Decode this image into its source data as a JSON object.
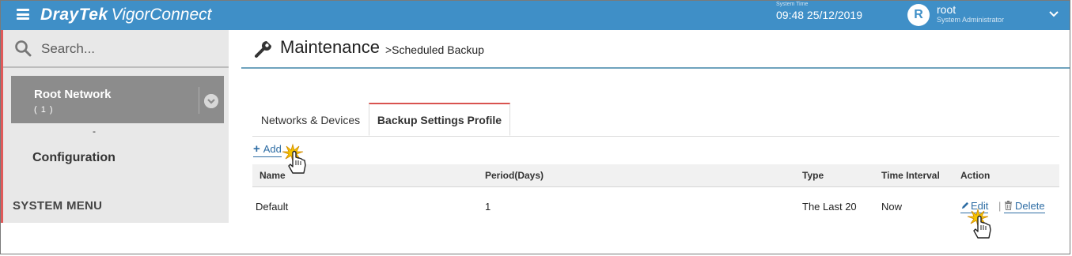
{
  "app": {
    "brand_bold": "DrayTek",
    "brand_rest": "VigorConnect"
  },
  "header": {
    "system_time_label": "System Time",
    "system_time": "09:48 25/12/2019",
    "avatar_letter": "R",
    "user_name": "root",
    "user_role": "System Administrator"
  },
  "sidebar": {
    "search_placeholder": "Search...",
    "network_name": "Root Network",
    "network_count": "( 1 )",
    "dash": "-",
    "configuration": "Configuration",
    "system_menu": "SYSTEM MENU"
  },
  "page": {
    "title": "Maintenance",
    "breadcrumb": ">Scheduled Backup"
  },
  "tabs": [
    {
      "label": "Networks & Devices",
      "active": false
    },
    {
      "label": "Backup Settings Profile",
      "active": true
    }
  ],
  "toolbar": {
    "add_label": "Add"
  },
  "table": {
    "columns": [
      "Name",
      "Period(Days)",
      "Type",
      "Time Interval",
      "Action"
    ],
    "rows": [
      {
        "name": "Default",
        "period": "1",
        "type": "The Last 20",
        "interval": "Now",
        "edit": "Edit",
        "separator": "|",
        "delete": "Delete"
      }
    ]
  },
  "colors": {
    "topbar": "#3f8fc7",
    "link": "#2e6da4",
    "active_tab_accent": "#d9534f"
  }
}
